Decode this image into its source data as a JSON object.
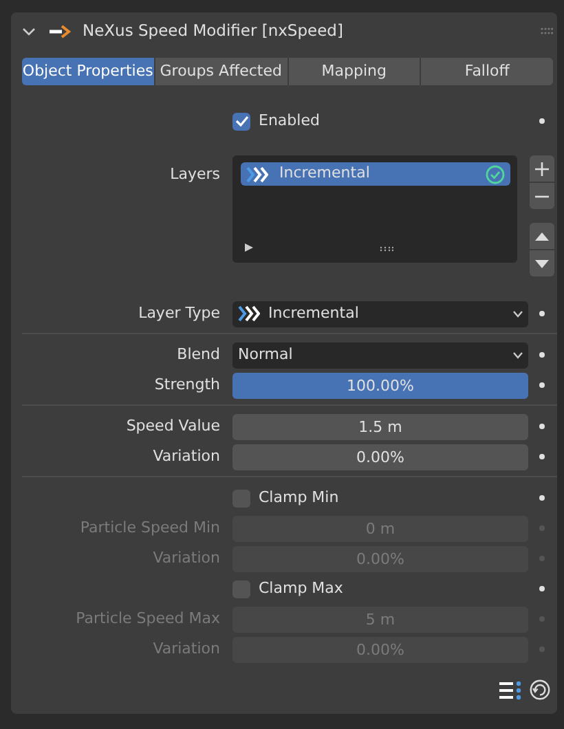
{
  "panel": {
    "title": "NeXus Speed Modifier [nxSpeed]",
    "expanded": true
  },
  "tabs": [
    {
      "label": "Object Properties",
      "selected": true
    },
    {
      "label": "Groups Affected",
      "selected": false
    },
    {
      "label": "Mapping",
      "selected": false
    },
    {
      "label": "Falloff",
      "selected": false
    }
  ],
  "sections": [
    [
      {
        "kind": "checkbox",
        "label": "Enabled",
        "checked": true,
        "disabled": false
      },
      {
        "kind": "list",
        "label": "Layers",
        "items": [
          {
            "name": "Incremental",
            "selected": true,
            "enabled": true
          }
        ]
      },
      {
        "kind": "dropdown",
        "label": "Layer Type",
        "value": "Incremental",
        "icon": true
      }
    ],
    [
      {
        "kind": "dropdown",
        "label": "Blend",
        "value": "Normal",
        "icon": false
      },
      {
        "kind": "slider",
        "label": "Strength",
        "value": "100.00%",
        "level": 1
      }
    ],
    [
      {
        "kind": "number",
        "label": "Speed Value",
        "value": "1.5 m",
        "disabled": false
      },
      {
        "kind": "number",
        "label": "Variation",
        "value": "0.00%",
        "disabled": false
      }
    ],
    [
      {
        "kind": "checkbox",
        "label": "Clamp Min",
        "checked": false,
        "disabled": false
      },
      {
        "kind": "number",
        "label": "Particle Speed Min",
        "value": "0 m",
        "disabled": true
      },
      {
        "kind": "number",
        "label": "Variation",
        "value": "0.00%",
        "disabled": true
      },
      {
        "kind": "checkbox",
        "label": "Clamp Max",
        "checked": false,
        "disabled": false
      },
      {
        "kind": "number",
        "label": "Particle Speed Max",
        "value": "5 m",
        "disabled": true
      },
      {
        "kind": "number",
        "label": "Variation",
        "value": "0.00%",
        "disabled": true
      }
    ]
  ]
}
